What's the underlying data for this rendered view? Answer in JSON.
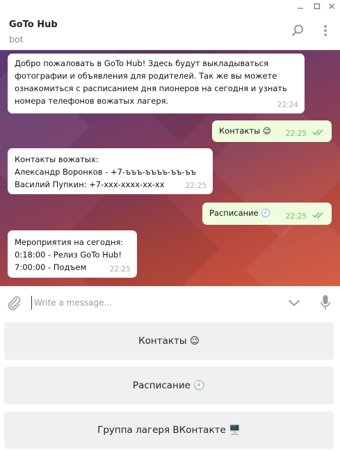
{
  "window": {
    "minimize_icon": "minimize-icon",
    "maximize_icon": "maximize-icon",
    "close_icon": "close-icon"
  },
  "header": {
    "title": "GoTo Hub",
    "subtitle": "bot",
    "search_icon": "search-icon",
    "menu_icon": "more-vertical-icon"
  },
  "messages": [
    {
      "direction": "incoming",
      "lines": [
        "Добро пожаловать в GoTo Hub! Здесь будут выкладываться",
        "фотографии и объявления для родителей. Так же вы можете",
        "ознакомиться с расписанием дня пионеров на сегодня и узнать",
        "номера телефонов вожатых лагеря."
      ],
      "time": "22:24"
    },
    {
      "direction": "outgoing",
      "lines": [
        "Контакты 😉"
      ],
      "time": "22:25",
      "status_icon": "double-check-icon"
    },
    {
      "direction": "incoming",
      "lines": [
        "Контакты вожатых:",
        "Александр Воронков - +7-ъъъ-ъъъъ-ъъ-ъъ",
        "Василий Пупкин: +7-xxx-xxxx-xx-xx"
      ],
      "time": "22:25"
    },
    {
      "direction": "outgoing",
      "lines": [
        "Расписание 🕘"
      ],
      "time": "22:25",
      "status_icon": "double-check-icon"
    },
    {
      "direction": "incoming",
      "lines": [
        "Мероприятия на сегодня:",
        "0:18:00 - Релиз GoTo Hub!",
        "7:00:00 - Подъем"
      ],
      "time": "22:25"
    }
  ],
  "composer": {
    "placeholder": "Write a message...",
    "value": "",
    "attach_icon": "paperclip-icon",
    "keyboard_toggle_icon": "chevron-down-icon",
    "mic_icon": "microphone-icon"
  },
  "keyboard": {
    "buttons": [
      "Контакты 😉",
      "Расписание 🕘",
      "Группа лагеря ВКонтакте 🖥️"
    ]
  },
  "colors": {
    "incoming_bubble": "#ffffff",
    "outgoing_bubble": "#effdde",
    "read_check": "#5fbf55",
    "keyboard_button": "#f0f0f0"
  }
}
